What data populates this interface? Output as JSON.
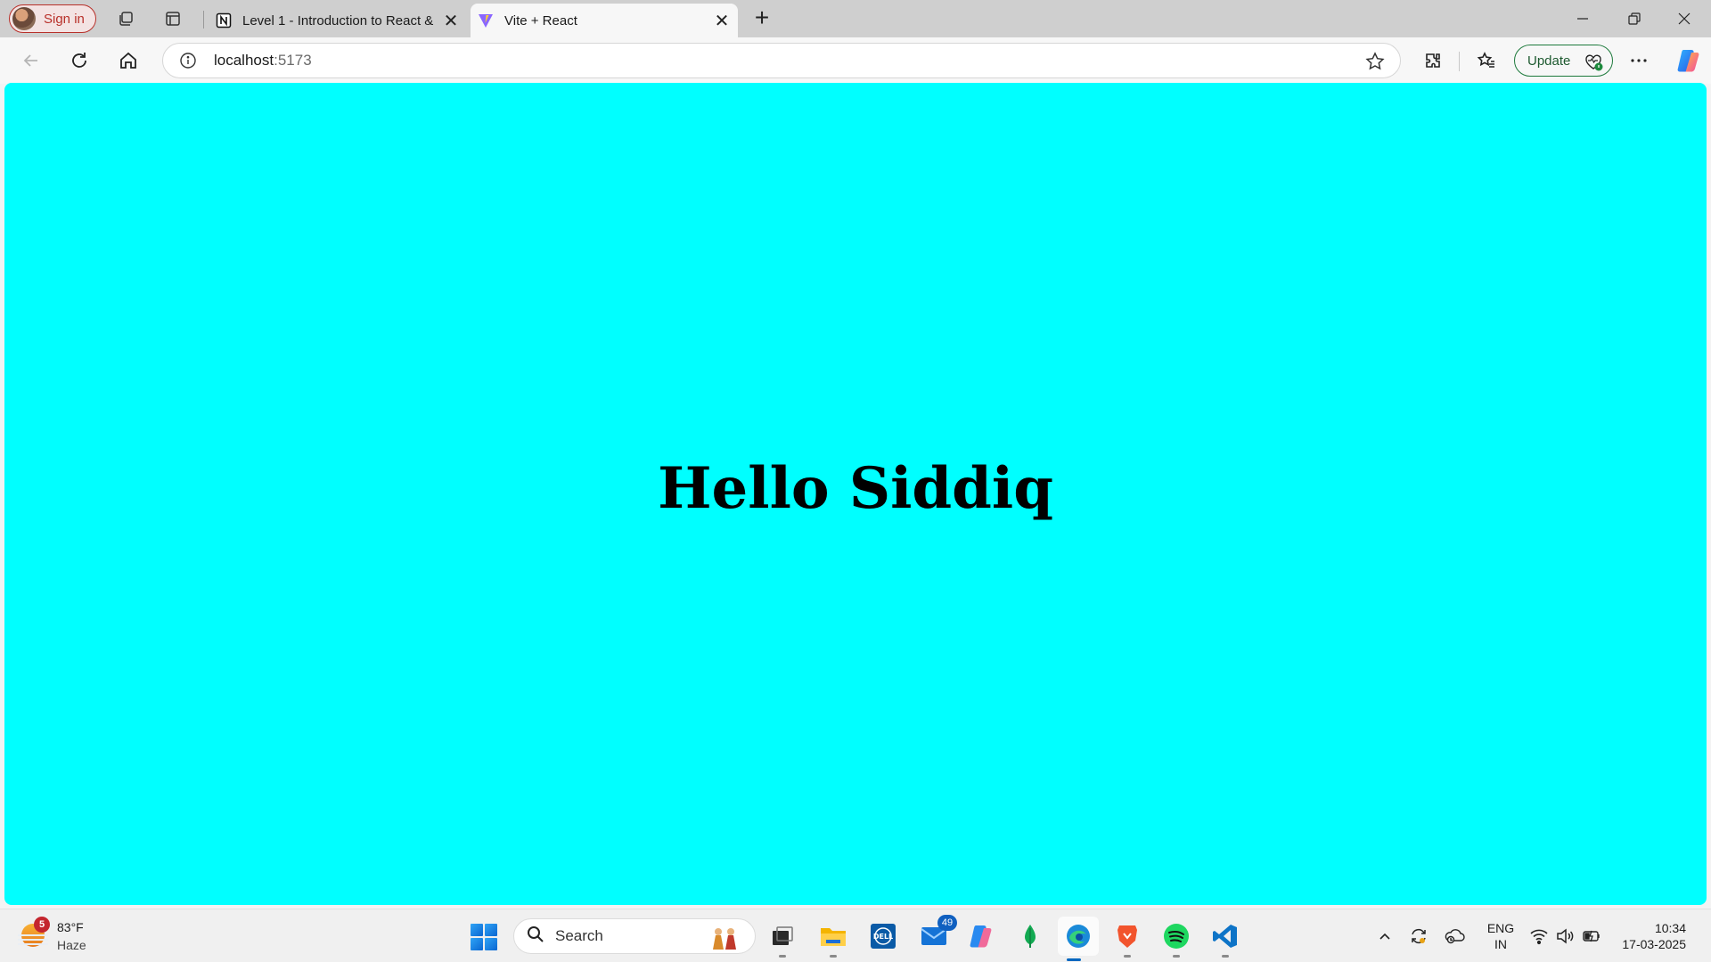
{
  "browser": {
    "profile_button": "Sign in",
    "tabs": [
      {
        "title": "Level 1 - Introduction to React &",
        "favicon": "notion-icon"
      },
      {
        "title": "Vite + React",
        "favicon": "vite-icon",
        "active": true
      }
    ],
    "address_bar": {
      "host": "localhost",
      "port": ":5173"
    },
    "update_button": "Update"
  },
  "page": {
    "heading": "Hello Siddiq",
    "background_color": "#00ffff"
  },
  "taskbar": {
    "weather": {
      "badge": "5",
      "temperature": "83°F",
      "condition": "Haze"
    },
    "search_label": "Search",
    "mail_badge": "49",
    "language": {
      "line1": "ENG",
      "line2": "IN"
    },
    "clock": {
      "time": "10:34",
      "date": "17-03-2025"
    }
  }
}
